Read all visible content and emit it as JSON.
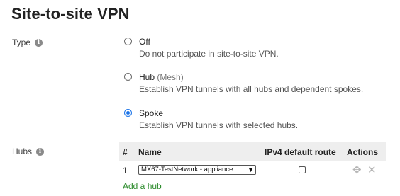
{
  "page": {
    "title": "Site-to-site VPN"
  },
  "type_field": {
    "label": "Type",
    "options": [
      {
        "title": "Off",
        "subtitle": "",
        "description": "Do not participate in site-to-site VPN.",
        "checked": false
      },
      {
        "title": "Hub",
        "subtitle": "(Mesh)",
        "description": "Establish VPN tunnels with all hubs and dependent spokes.",
        "checked": false
      },
      {
        "title": "Spoke",
        "subtitle": "",
        "description": "Establish VPN tunnels with selected hubs.",
        "checked": true
      }
    ]
  },
  "hubs_field": {
    "label": "Hubs",
    "columns": [
      "#",
      "Name",
      "IPv4 default route",
      "Actions"
    ],
    "rows": [
      {
        "index": "1",
        "name": "MX67-TestNetwork - appliance",
        "ipv4_default_route": false
      }
    ],
    "add_link": "Add a hub"
  },
  "icons": {
    "info": "info-icon",
    "move": "move-icon",
    "remove": "close-icon"
  },
  "colors": {
    "accent": "#1a73e8",
    "link": "#2a8a2a",
    "table_header_bg": "#eeeeee"
  }
}
